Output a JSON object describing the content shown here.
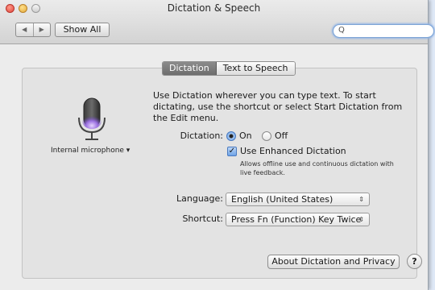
{
  "window": {
    "title": "Dictation & Speech"
  },
  "toolbar": {
    "back_glyph": "◀",
    "forward_glyph": "▶",
    "show_all": "Show All",
    "search_glyph": "Q",
    "search_value": ""
  },
  "tabs": [
    {
      "label": "Dictation",
      "active": true
    },
    {
      "label": "Text to Speech",
      "active": false
    }
  ],
  "mic": {
    "source_label": "Internal microphone ▾"
  },
  "description": "Use Dictation wherever you can type text. To start dictating, use the shortcut or select Start Dictation from the Edit menu.",
  "dictation": {
    "label": "Dictation:",
    "on_label": "On",
    "off_label": "Off",
    "selected": "On",
    "enhanced_label": "Use Enhanced Dictation",
    "enhanced_checked": true,
    "enhanced_note": "Allows offline use and continuous dictation with live feedback."
  },
  "language": {
    "label": "Language:",
    "value": "English (United States)"
  },
  "shortcut": {
    "label": "Shortcut:",
    "value": "Press Fn (Function) Key Twice"
  },
  "footer": {
    "about_button": "About Dictation and Privacy",
    "help_glyph": "?"
  },
  "colors": {
    "accent": "#6ea3e6",
    "window_bg": "#ececec",
    "tab_active": "#7a7a7a"
  }
}
